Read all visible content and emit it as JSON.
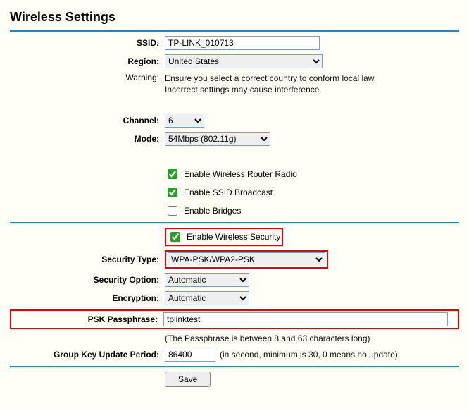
{
  "page": {
    "title": "Wireless Settings"
  },
  "ssid": {
    "label": "SSID:",
    "value": "TP-LINK_010713"
  },
  "region": {
    "label": "Region:",
    "value": "United States"
  },
  "warning": {
    "label": "Warning:",
    "text": "Ensure you select a correct country to conform local law. Incorrect settings may cause interference."
  },
  "channel": {
    "label": "Channel:",
    "value": "6"
  },
  "mode": {
    "label": "Mode:",
    "value": "54Mbps (802.11g)"
  },
  "checks": {
    "radio": {
      "label": "Enable Wireless Router Radio",
      "checked": true
    },
    "ssid_broadcast": {
      "label": "Enable SSID Broadcast",
      "checked": true
    },
    "bridges": {
      "label": "Enable Bridges",
      "checked": false
    },
    "security": {
      "label": "Enable Wireless Security",
      "checked": true
    }
  },
  "security_type": {
    "label": "Security Type:",
    "value": "WPA-PSK/WPA2-PSK"
  },
  "security_option": {
    "label": "Security Option:",
    "value": "Automatic"
  },
  "encryption": {
    "label": "Encryption:",
    "value": "Automatic"
  },
  "psk": {
    "label": "PSK Passphrase:",
    "value": "tplinktest",
    "hint": "(The Passphrase is between 8 and 63 characters long)"
  },
  "group_key": {
    "label": "Group Key Update Period:",
    "value": "86400",
    "hint": "(in second, minimum is 30, 0 means no update)"
  },
  "buttons": {
    "save": "Save"
  }
}
